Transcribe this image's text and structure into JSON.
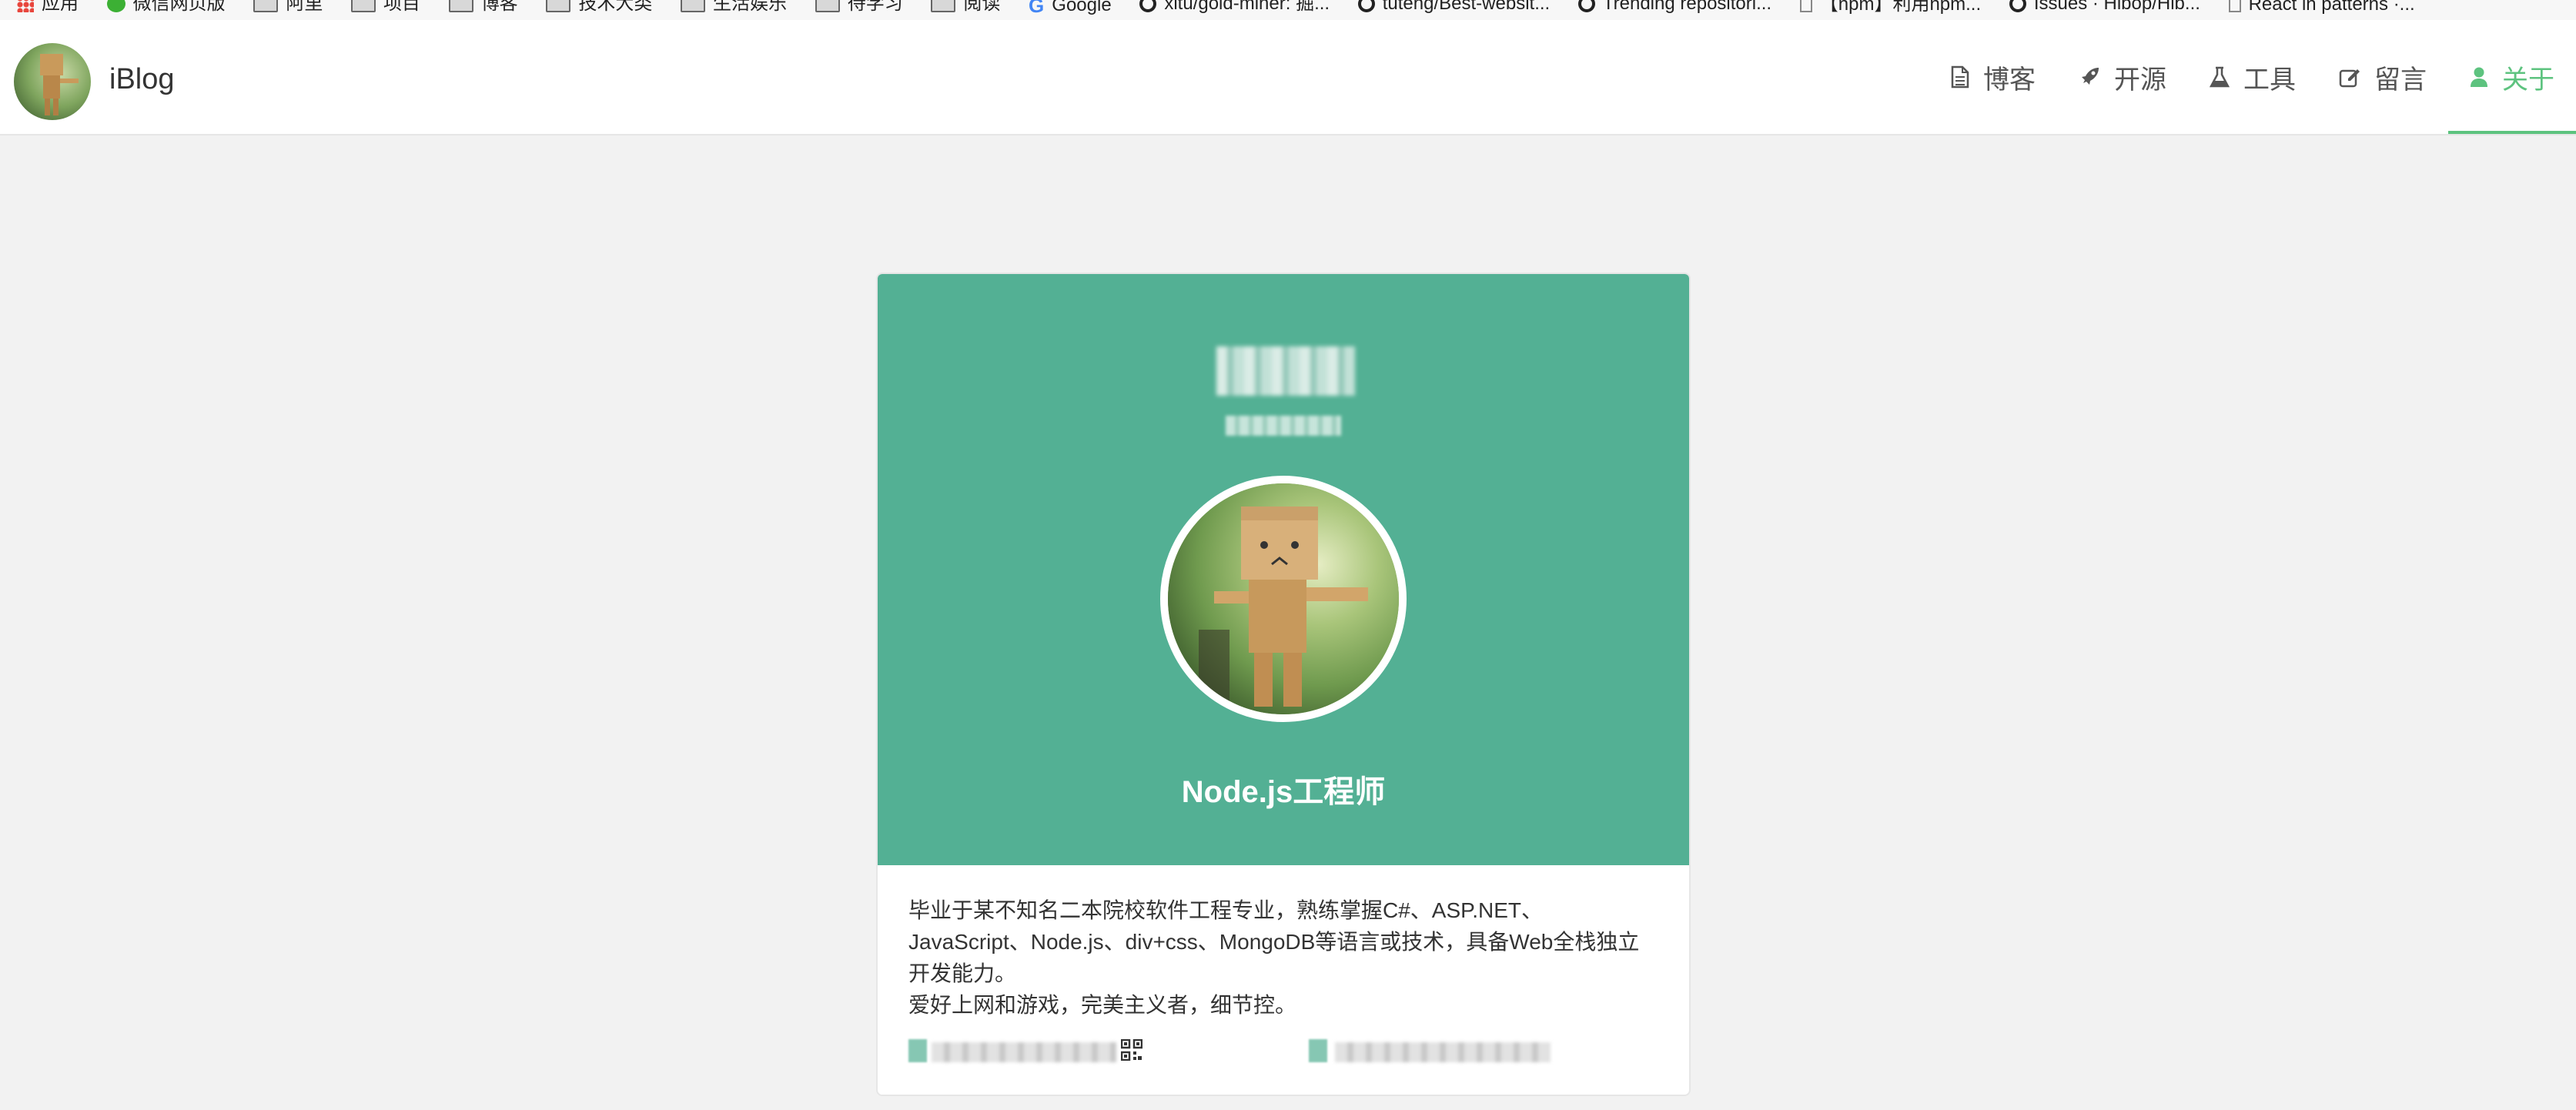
{
  "bookmarks": [
    {
      "label": "应用",
      "icon": "apps-grid-icon"
    },
    {
      "label": "微信网页版",
      "icon": "wechat-icon"
    },
    {
      "label": "阿里",
      "icon": "folder-icon"
    },
    {
      "label": "项目",
      "icon": "folder-icon"
    },
    {
      "label": "博客",
      "icon": "folder-icon"
    },
    {
      "label": "技术大类",
      "icon": "folder-icon"
    },
    {
      "label": "生活娱乐",
      "icon": "folder-icon"
    },
    {
      "label": "待学习",
      "icon": "folder-icon"
    },
    {
      "label": "阅读",
      "icon": "folder-icon"
    },
    {
      "label": "Google",
      "icon": "google-icon"
    },
    {
      "label": "xitu/gold-miner: 掘...",
      "icon": "github-icon"
    },
    {
      "label": "tuteng/Best-websit...",
      "icon": "github-icon"
    },
    {
      "label": "Trending repositori...",
      "icon": "github-icon"
    },
    {
      "label": "【npm】利用npm...",
      "icon": "page-icon"
    },
    {
      "label": "Issues · Hibop/Hib...",
      "icon": "github-icon"
    },
    {
      "label": "React in patterns ·...",
      "icon": "page-icon"
    }
  ],
  "header": {
    "brand": "iBlog",
    "nav": [
      {
        "label": "博客",
        "icon": "file-text-icon",
        "active": false
      },
      {
        "label": "开源",
        "icon": "rocket-icon",
        "active": false
      },
      {
        "label": "工具",
        "icon": "flask-icon",
        "active": false
      },
      {
        "label": "留言",
        "icon": "edit-icon",
        "active": false
      },
      {
        "label": "关于",
        "icon": "user-icon",
        "active": true
      }
    ],
    "active_color": "#5dc37f"
  },
  "profile": {
    "role": "Node.js工程师",
    "bio_lines": [
      "毕业于某不知名二本院校软件工程专业，熟练掌握C#、ASP.NET、JavaScript、Node.js、div+css、MongoDB等语言或技术，具备Web全栈独立开发能力。",
      "爱好上网和游戏，完美主义者，细节控。"
    ],
    "card_color": "#53b094"
  }
}
